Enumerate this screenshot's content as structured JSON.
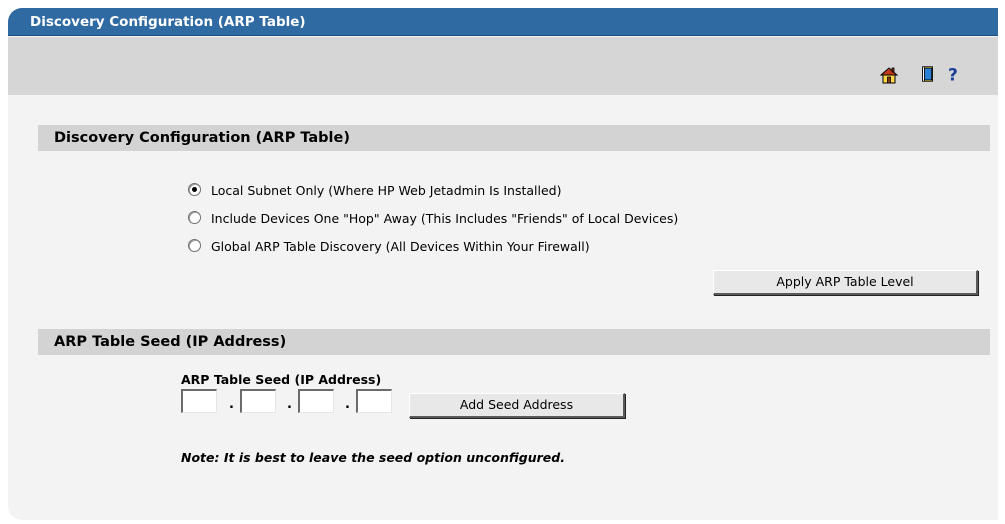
{
  "window": {
    "title": "Discovery Configuration (ARP Table)"
  },
  "toolbar": {
    "icons": [
      "home-icon",
      "book-icon",
      "help-icon"
    ],
    "help_glyph": "?"
  },
  "arp_section": {
    "header": "Discovery Configuration (ARP Table)",
    "options": [
      {
        "label": "Local Subnet Only (Where HP Web Jetadmin Is Installed)",
        "selected": true
      },
      {
        "label": "Include Devices One \"Hop\" Away (This Includes \"Friends\" of Local Devices)",
        "selected": false
      },
      {
        "label": "Global ARP Table Discovery (All Devices Within Your Firewall)",
        "selected": false
      }
    ],
    "apply_button": "Apply ARP Table Level"
  },
  "seed_section": {
    "header": "ARP Table Seed (IP Address)",
    "field_label": "ARP Table Seed (IP Address)",
    "octets": [
      "",
      "",
      "",
      ""
    ],
    "octet_separator": ".",
    "add_button": "Add Seed Address",
    "note": "Note: It is best to leave the seed option unconfigured."
  },
  "colors": {
    "title_bar": "#2f6aa3",
    "panel_background": "#f3f3f3",
    "toolbar_background": "#d6d6d6",
    "section_header": "#d3d3d3",
    "help_icon": "#1e3f99"
  }
}
